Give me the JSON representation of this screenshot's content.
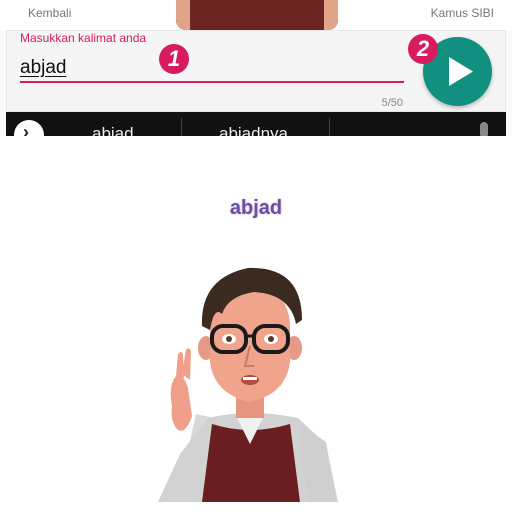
{
  "nav": {
    "back_label": "Kembali",
    "dictionary_label": "Kamus SIBI"
  },
  "input": {
    "label": "Masukkan kalimat anda",
    "value": "abjad",
    "counter": "5/50"
  },
  "badges": {
    "first": "1",
    "second": "2"
  },
  "play_button": {
    "icon": "play-icon",
    "color": "#11907f"
  },
  "suggestions": [
    "abjad",
    "abjadnya"
  ],
  "caption": {
    "word": "abjad"
  },
  "colors": {
    "accent": "#d81b60",
    "play": "#11907f",
    "caption": "#6b4fa0"
  }
}
